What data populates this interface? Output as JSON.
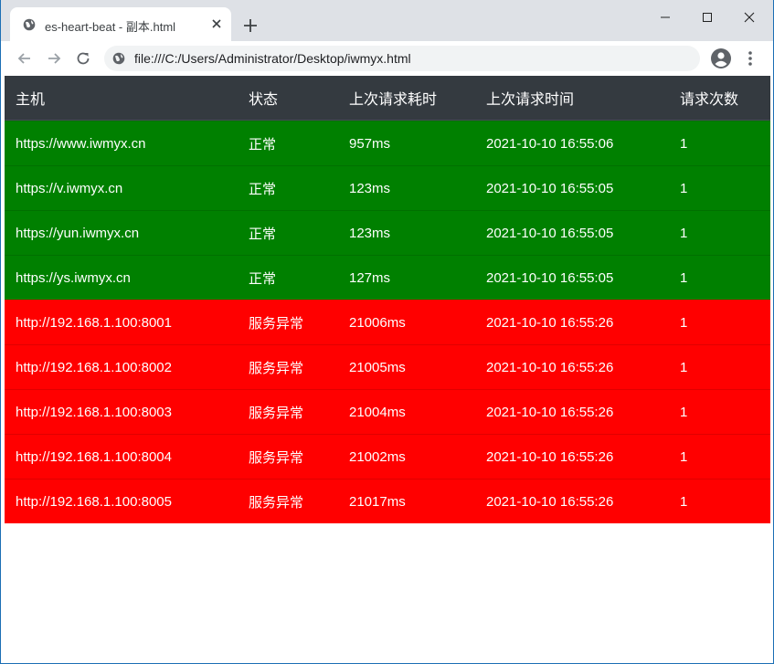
{
  "browser": {
    "tab_title": "es-heart-beat - 副本.html",
    "url": "file:///C:/Users/Administrator/Desktop/iwmyx.html"
  },
  "table": {
    "headers": [
      "主机",
      "状态",
      "上次请求耗时",
      "上次请求时间",
      "请求次数"
    ],
    "rows": [
      {
        "host": "https://www.iwmyx.cn",
        "status": "正常",
        "latency": "957ms",
        "time": "2021-10-10 16:55:06",
        "count": "1",
        "color": "#008000"
      },
      {
        "host": "https://v.iwmyx.cn",
        "status": "正常",
        "latency": "123ms",
        "time": "2021-10-10 16:55:05",
        "count": "1",
        "color": "#008000"
      },
      {
        "host": "https://yun.iwmyx.cn",
        "status": "正常",
        "latency": "123ms",
        "time": "2021-10-10 16:55:05",
        "count": "1",
        "color": "#008000"
      },
      {
        "host": "https://ys.iwmyx.cn",
        "status": "正常",
        "latency": "127ms",
        "time": "2021-10-10 16:55:05",
        "count": "1",
        "color": "#008000"
      },
      {
        "host": "http://192.168.1.100:8001",
        "status": "服务异常",
        "latency": "21006ms",
        "time": "2021-10-10 16:55:26",
        "count": "1",
        "color": "#ff0000"
      },
      {
        "host": "http://192.168.1.100:8002",
        "status": "服务异常",
        "latency": "21005ms",
        "time": "2021-10-10 16:55:26",
        "count": "1",
        "color": "#ff0000"
      },
      {
        "host": "http://192.168.1.100:8003",
        "status": "服务异常",
        "latency": "21004ms",
        "time": "2021-10-10 16:55:26",
        "count": "1",
        "color": "#ff0000"
      },
      {
        "host": "http://192.168.1.100:8004",
        "status": "服务异常",
        "latency": "21002ms",
        "time": "2021-10-10 16:55:26",
        "count": "1",
        "color": "#ff0000"
      },
      {
        "host": "http://192.168.1.100:8005",
        "status": "服务异常",
        "latency": "21017ms",
        "time": "2021-10-10 16:55:26",
        "count": "1",
        "color": "#ff0000"
      }
    ]
  },
  "icons": {
    "favicon": "globe-icon",
    "tab_close": "close-icon",
    "new_tab": "plus-icon",
    "back": "arrow-left-icon",
    "forward": "arrow-right-icon",
    "reload": "reload-icon",
    "site_info": "info-icon",
    "profile": "account-icon",
    "menu": "kebab-menu-icon"
  }
}
